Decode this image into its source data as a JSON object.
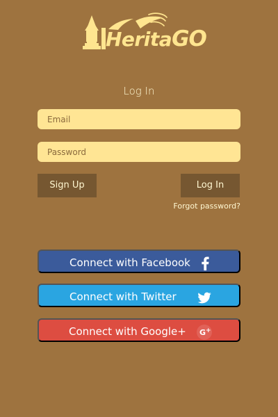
{
  "app": {
    "logo_text_main": "Herita",
    "logo_text_accent": "GO",
    "logo_icon": "temple-icon"
  },
  "login": {
    "title": "Log In",
    "email_placeholder": "Email",
    "password_placeholder": "Password",
    "signup_label": "Sign Up",
    "login_label": "Log In",
    "forgot_password_label": "Forgot password?"
  },
  "social": {
    "facebook_label": "Connect with Facebook",
    "twitter_label": "Connect with Twitter",
    "google_label": "Connect with Google+",
    "facebook_icon": "facebook-icon",
    "twitter_icon": "twitter-icon",
    "google_icon": "google-plus-icon"
  },
  "colors": {
    "background": "#9e733f",
    "input_fill": "#ffe594",
    "button_fill": "#765731",
    "facebook": "#3b5b9b",
    "twitter": "#2aa5e1",
    "google": "#dd4d41"
  }
}
